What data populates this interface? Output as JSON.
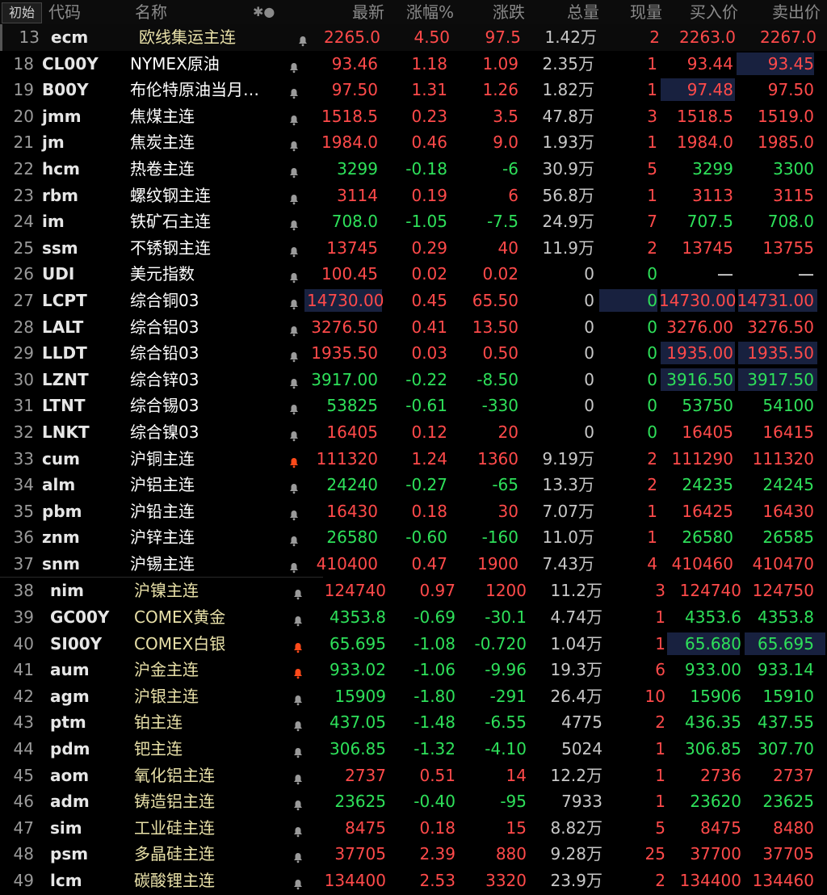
{
  "header": {
    "init_label": "初始",
    "code_label": "代码",
    "name_label": "名称",
    "icons_label": "✱●",
    "cols": [
      "最新",
      "涨幅%",
      "涨跌",
      "总量",
      "现量",
      "买入价",
      "卖出价"
    ]
  },
  "rows": [
    {
      "n": "13",
      "code": "ecm",
      "name": "欧线集运主连",
      "last": "2265.0",
      "pct": "4.50",
      "chg": "97.5",
      "vol": "1.42",
      "unit": "万",
      "cur": "2",
      "bid": "2263.0",
      "ask": "2267.0",
      "c": "red",
      "nc": "yellow",
      "alert": false
    },
    {
      "n": "18",
      "code": "CL00Y",
      "name": "NYMEX原油",
      "last": "93.46",
      "pct": "1.18",
      "chg": "1.09",
      "vol": "2.35",
      "unit": "万",
      "cur": "1",
      "bid": "93.44",
      "ask": "93.45",
      "c": "red",
      "nc": "yellow",
      "alert": false
    },
    {
      "n": "19",
      "code": "B00Y",
      "name": "布伦特原油当月…",
      "last": "97.50",
      "pct": "1.31",
      "chg": "1.26",
      "vol": "1.82",
      "unit": "万",
      "cur": "1",
      "bid": "97.48",
      "ask": "97.50",
      "c": "red",
      "nc": "yellow",
      "alert": false
    },
    {
      "n": "20",
      "code": "jmm",
      "name": "焦煤主连",
      "last": "1518.5",
      "pct": "0.23",
      "chg": "3.5",
      "vol": "47.8",
      "unit": "万",
      "cur": "3",
      "bid": "1518.5",
      "ask": "1519.0",
      "c": "red",
      "nc": "yellow",
      "alert": false
    },
    {
      "n": "21",
      "code": "jm",
      "name": "焦炭主连",
      "last": "1984.0",
      "pct": "0.46",
      "chg": "9.0",
      "vol": "1.93",
      "unit": "万",
      "cur": "1",
      "bid": "1984.0",
      "ask": "1985.0",
      "c": "red",
      "nc": "yellow",
      "alert": false
    },
    {
      "n": "22",
      "code": "hcm",
      "name": "热卷主连",
      "last": "3299",
      "pct": "-0.18",
      "chg": "-6",
      "vol": "30.9",
      "unit": "万",
      "cur": "5",
      "bid": "3299",
      "ask": "3300",
      "c": "green",
      "nc": "yellow",
      "alert": false
    },
    {
      "n": "23",
      "code": "rbm",
      "name": "螺纹钢主连",
      "last": "3114",
      "pct": "0.19",
      "chg": "6",
      "vol": "56.8",
      "unit": "万",
      "cur": "1",
      "bid": "3113",
      "ask": "3115",
      "c": "red",
      "nc": "yellow",
      "alert": false
    },
    {
      "n": "24",
      "code": "im",
      "name": "铁矿石主连",
      "last": "708.0",
      "pct": "-1.05",
      "chg": "-7.5",
      "vol": "24.9",
      "unit": "万",
      "cur": "7",
      "bid": "707.5",
      "ask": "708.0",
      "c": "green",
      "nc": "yellow",
      "alert": false
    },
    {
      "n": "25",
      "code": "ssm",
      "name": "不锈钢主连",
      "last": "13745",
      "pct": "0.29",
      "chg": "40",
      "vol": "11.9",
      "unit": "万",
      "cur": "2",
      "bid": "13745",
      "ask": "13755",
      "c": "red",
      "nc": "yellow",
      "alert": false
    },
    {
      "n": "26",
      "code": "UDI",
      "name": "美元指数",
      "last": "100.45",
      "pct": "0.02",
      "chg": "0.02",
      "vol": "0",
      "unit": "",
      "cur": "0",
      "bid": "—",
      "ask": "—",
      "c": "red",
      "nc": "yellow",
      "alert": false
    },
    {
      "n": "27",
      "code": "LCPT",
      "name": "综合铜03",
      "last": "14730.00",
      "pct": "0.45",
      "chg": "65.50",
      "vol": "0",
      "unit": "",
      "cur": "0",
      "bid": "14730.00",
      "ask": "14731.00",
      "c": "red",
      "nc": "yellow",
      "alert": false
    },
    {
      "n": "28",
      "code": "LALT",
      "name": "综合铝03",
      "last": "3276.50",
      "pct": "0.41",
      "chg": "13.50",
      "vol": "0",
      "unit": "",
      "cur": "0",
      "bid": "3276.00",
      "ask": "3276.50",
      "c": "red",
      "nc": "yellow",
      "alert": false
    },
    {
      "n": "29",
      "code": "LLDT",
      "name": "综合铅03",
      "last": "1935.50",
      "pct": "0.03",
      "chg": "0.50",
      "vol": "0",
      "unit": "",
      "cur": "0",
      "bid": "1935.00",
      "ask": "1935.50",
      "c": "red",
      "nc": "yellow",
      "alert": false
    },
    {
      "n": "30",
      "code": "LZNT",
      "name": "综合锌03",
      "last": "3917.00",
      "pct": "-0.22",
      "chg": "-8.50",
      "vol": "0",
      "unit": "",
      "cur": "0",
      "bid": "3916.50",
      "ask": "3917.50",
      "c": "green",
      "nc": "yellow",
      "alert": false
    },
    {
      "n": "31",
      "code": "LTNT",
      "name": "综合锡03",
      "last": "53825",
      "pct": "-0.61",
      "chg": "-330",
      "vol": "0",
      "unit": "",
      "cur": "0",
      "bid": "53750",
      "ask": "54100",
      "c": "green",
      "nc": "yellow",
      "alert": false
    },
    {
      "n": "32",
      "code": "LNKT",
      "name": "综合镍03",
      "last": "16405",
      "pct": "0.12",
      "chg": "20",
      "vol": "0",
      "unit": "",
      "cur": "0",
      "bid": "16405",
      "ask": "16415",
      "c": "red",
      "nc": "yellow",
      "alert": false
    },
    {
      "n": "33",
      "code": "cum",
      "name": "沪铜主连",
      "last": "111320",
      "pct": "1.24",
      "chg": "1360",
      "vol": "9.19",
      "unit": "万",
      "cur": "2",
      "bid": "111290",
      "ask": "111320",
      "c": "red",
      "nc": "yellow",
      "alert": true
    },
    {
      "n": "34",
      "code": "alm",
      "name": "沪铝主连",
      "last": "24240",
      "pct": "-0.27",
      "chg": "-65",
      "vol": "13.3",
      "unit": "万",
      "cur": "2",
      "bid": "24235",
      "ask": "24245",
      "c": "green",
      "nc": "yellow",
      "alert": false
    },
    {
      "n": "35",
      "code": "pbm",
      "name": "沪铅主连",
      "last": "16430",
      "pct": "0.18",
      "chg": "30",
      "vol": "7.07",
      "unit": "万",
      "cur": "1",
      "bid": "16425",
      "ask": "16430",
      "c": "red",
      "nc": "yellow",
      "alert": false
    },
    {
      "n": "36",
      "code": "znm",
      "name": "沪锌主连",
      "last": "26580",
      "pct": "-0.60",
      "chg": "-160",
      "vol": "11.0",
      "unit": "万",
      "cur": "1",
      "bid": "26580",
      "ask": "26585",
      "c": "green",
      "nc": "yellow",
      "alert": false
    },
    {
      "n": "37",
      "code": "snm",
      "name": "沪锡主连",
      "last": "410400",
      "pct": "0.47",
      "chg": "1900",
      "vol": "7.43",
      "unit": "万",
      "cur": "4",
      "bid": "410460",
      "ask": "410470",
      "c": "red",
      "nc": "yellow",
      "alert": false
    },
    {
      "n": "38",
      "code": "nim",
      "name": "沪镍主连",
      "last": "124740",
      "pct": "0.97",
      "chg": "1200",
      "vol": "11.2",
      "unit": "万",
      "cur": "3",
      "bid": "124740",
      "ask": "124750",
      "c": "red",
      "nc": "yellow",
      "alert": false
    },
    {
      "n": "39",
      "code": "GC00Y",
      "name": "COMEX黄金",
      "last": "4353.8",
      "pct": "-0.69",
      "chg": "-30.1",
      "vol": "4.74",
      "unit": "万",
      "cur": "1",
      "bid": "4353.6",
      "ask": "4353.8",
      "c": "green",
      "nc": "yellow",
      "alert": false
    },
    {
      "n": "40",
      "code": "SI00Y",
      "name": "COMEX白银",
      "last": "65.695",
      "pct": "-1.08",
      "chg": "-0.720",
      "vol": "1.04",
      "unit": "万",
      "cur": "1",
      "bid": "65.680",
      "ask": "65.695",
      "c": "green",
      "nc": "yellow",
      "alert": true
    },
    {
      "n": "41",
      "code": "aum",
      "name": "沪金主连",
      "last": "933.02",
      "pct": "-1.06",
      "chg": "-9.96",
      "vol": "19.3",
      "unit": "万",
      "cur": "6",
      "bid": "933.00",
      "ask": "933.14",
      "c": "green",
      "nc": "yellow",
      "alert": true
    },
    {
      "n": "42",
      "code": "agm",
      "name": "沪银主连",
      "last": "15909",
      "pct": "-1.80",
      "chg": "-291",
      "vol": "26.4",
      "unit": "万",
      "cur": "10",
      "bid": "15906",
      "ask": "15910",
      "c": "green",
      "nc": "yellow",
      "alert": false
    },
    {
      "n": "43",
      "code": "ptm",
      "name": "铂主连",
      "last": "437.05",
      "pct": "-1.48",
      "chg": "-6.55",
      "vol": "4775",
      "unit": "",
      "cur": "2",
      "bid": "436.35",
      "ask": "437.55",
      "c": "green",
      "nc": "yellow",
      "alert": false
    },
    {
      "n": "44",
      "code": "pdm",
      "name": "钯主连",
      "last": "306.85",
      "pct": "-1.32",
      "chg": "-4.10",
      "vol": "5024",
      "unit": "",
      "cur": "1",
      "bid": "306.85",
      "ask": "307.70",
      "c": "green",
      "nc": "yellow",
      "alert": false
    },
    {
      "n": "45",
      "code": "aom",
      "name": "氧化铝主连",
      "last": "2737",
      "pct": "0.51",
      "chg": "14",
      "vol": "12.2",
      "unit": "万",
      "cur": "1",
      "bid": "2736",
      "ask": "2737",
      "c": "red",
      "nc": "yellow",
      "alert": false
    },
    {
      "n": "46",
      "code": "adm",
      "name": "铸造铝主连",
      "last": "23625",
      "pct": "-0.40",
      "chg": "-95",
      "vol": "7933",
      "unit": "",
      "cur": "1",
      "bid": "23620",
      "ask": "23625",
      "c": "green",
      "nc": "yellow",
      "alert": false
    },
    {
      "n": "47",
      "code": "sim",
      "name": "工业硅主连",
      "last": "8475",
      "pct": "0.18",
      "chg": "15",
      "vol": "8.82",
      "unit": "万",
      "cur": "5",
      "bid": "8475",
      "ask": "8480",
      "c": "red",
      "nc": "yellow",
      "alert": false
    },
    {
      "n": "48",
      "code": "psm",
      "name": "多晶硅主连",
      "last": "37705",
      "pct": "2.39",
      "chg": "880",
      "vol": "9.28",
      "unit": "万",
      "cur": "25",
      "bid": "37700",
      "ask": "37705",
      "c": "red",
      "nc": "yellow",
      "alert": false
    },
    {
      "n": "49",
      "code": "lcm",
      "name": "碳酸锂主连",
      "last": "134400",
      "pct": "2.53",
      "chg": "3320",
      "vol": "23.9",
      "unit": "万",
      "cur": "2",
      "bid": "134400",
      "ask": "134460",
      "c": "red",
      "nc": "yellow",
      "alert": false
    }
  ],
  "colors": {
    "up": "#ff4a4a",
    "down": "#2ee05a",
    "name": "#e8e0a8",
    "alert": "#ff4a1a",
    "bell": "#9a9a9a",
    "highlight": "#18213f"
  }
}
